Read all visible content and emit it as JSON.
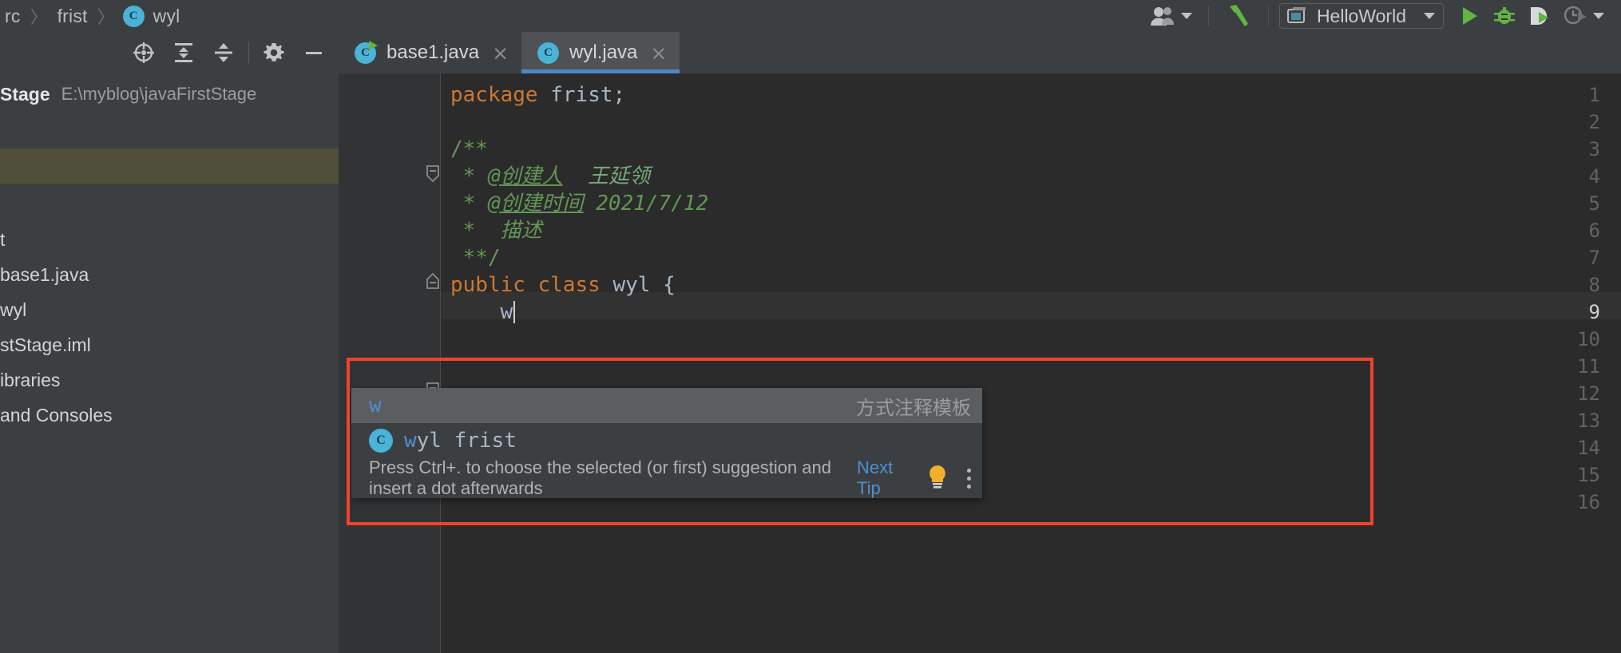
{
  "breadcrumb": {
    "items": [
      "rc",
      "frist",
      "wyl"
    ],
    "separator": "〉",
    "class_icon_letter": "C"
  },
  "top_toolbar": {
    "icons": [
      "users-icon",
      "build-hammer-icon",
      "run-icon",
      "debug-icon",
      "run-coverage-icon",
      "profiler-icon"
    ],
    "run_config": {
      "label": "HelloWorld",
      "icon": "run-config-icon"
    }
  },
  "sidebar": {
    "toolbar_icons": [
      "select-opened-file-icon",
      "expand-all-icon",
      "collapse-all-icon",
      "settings-gear-icon",
      "hide-panel-icon"
    ],
    "project_name": "Stage",
    "project_path": "E:\\myblog\\javaFirstStage",
    "tree": [
      {
        "label": "",
        "selected": true,
        "blank": true
      },
      {
        "label": "",
        "selected": false,
        "blank": true
      },
      {
        "label": "t",
        "selected": false,
        "blank": false
      },
      {
        "label": "base1.java",
        "selected": false,
        "blank": false
      },
      {
        "label": "wyl",
        "selected": false,
        "blank": false
      },
      {
        "label": "stStage.iml",
        "selected": false,
        "blank": false
      },
      {
        "label": "ibraries",
        "selected": false,
        "blank": false
      },
      {
        "label": "and Consoles",
        "selected": false,
        "blank": false
      }
    ]
  },
  "editor": {
    "tabs": [
      {
        "label": "base1.java",
        "active": false,
        "has_run_marker": true,
        "close_glyph": "×"
      },
      {
        "label": "wyl.java",
        "active": true,
        "has_run_marker": false,
        "close_glyph": "×"
      }
    ],
    "line_numbers": [
      "1",
      "2",
      "3",
      "4",
      "5",
      "6",
      "7",
      "8",
      "9",
      "10",
      "11",
      "12",
      "13",
      "14",
      "15",
      "16"
    ],
    "current_line": "9",
    "code_lines": [
      {
        "n": 1,
        "tokens": [
          {
            "t": "package ",
            "c": "kw"
          },
          {
            "t": "frist;",
            "c": "pl"
          }
        ]
      },
      {
        "n": 2,
        "tokens": []
      },
      {
        "n": 3,
        "tokens": [
          {
            "t": "/**",
            "c": "doc"
          }
        ]
      },
      {
        "n": 4,
        "tokens": [
          {
            "t": " * ",
            "c": "doc"
          },
          {
            "t": "@创建人",
            "c": "doc-tag"
          },
          {
            "t": "  ",
            "c": "doc"
          },
          {
            "t": "王延领",
            "c": "doc-val"
          }
        ]
      },
      {
        "n": 5,
        "tokens": [
          {
            "t": " * ",
            "c": "doc"
          },
          {
            "t": "@创建时间",
            "c": "doc-tag"
          },
          {
            "t": " 2021/7/12",
            "c": "doc-it"
          }
        ]
      },
      {
        "n": 6,
        "tokens": [
          {
            "t": " * ",
            "c": "doc"
          },
          {
            "t": " 描述",
            "c": "doc-it"
          }
        ]
      },
      {
        "n": 7,
        "tokens": [
          {
            "t": " **/",
            "c": "doc"
          }
        ]
      },
      {
        "n": 8,
        "tokens": [
          {
            "t": "public class ",
            "c": "kw"
          },
          {
            "t": "wyl {",
            "c": "pl"
          }
        ]
      },
      {
        "n": 9,
        "tokens": [
          {
            "t": "    w",
            "c": "pl"
          }
        ]
      },
      {
        "n": 10,
        "tokens": []
      },
      {
        "n": 11,
        "tokens": []
      },
      {
        "n": 12,
        "tokens": []
      },
      {
        "n": 13,
        "tokens": []
      },
      {
        "n": 14,
        "tokens": [
          {
            "t": "    }",
            "c": "pl"
          }
        ]
      },
      {
        "n": 15,
        "tokens": [
          {
            "t": "}",
            "c": "pl"
          }
        ]
      },
      {
        "n": 16,
        "tokens": []
      }
    ]
  },
  "completion_popup": {
    "items": [
      {
        "text_match": "w",
        "text_tail": "",
        "right_label": "方式注释模板",
        "selected": true,
        "icon": null
      },
      {
        "text_match": "w",
        "text_tail": "yl frist",
        "right_label": "",
        "selected": false,
        "icon": "class-icon"
      }
    ],
    "hint_text": "Press Ctrl+. to choose the selected (or first) suggestion and insert a dot afterwards",
    "hint_link": "Next Tip",
    "hint_icons": [
      "lightbulb-icon",
      "more-options-icon"
    ]
  },
  "annotation": {
    "color": "#f2412e",
    "shape": "rectangle"
  },
  "colors": {
    "chrome_bg": "#3c3f41",
    "editor_bg": "#2b2b2b",
    "gutter_bg": "#313335",
    "tab_active_bg": "#4e5254",
    "tab_underline": "#4a88c7",
    "accent_blue": "#4ab3d6",
    "keyword_orange": "#cc7832",
    "javadoc_green": "#629755",
    "run_green": "#62b543",
    "tree_selection": "#50503a",
    "annotation_red": "#f2412e"
  }
}
